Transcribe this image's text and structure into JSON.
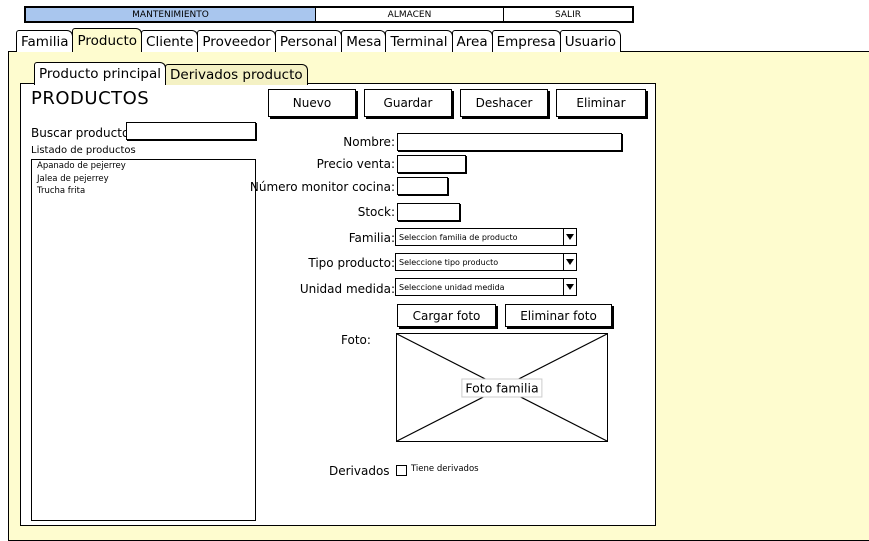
{
  "menubar": {
    "items": [
      "MANTENIMIENTO",
      "ALMACEN",
      "SALIR"
    ],
    "active_color": "#a9c6ee"
  },
  "main_tabs": [
    "Familia",
    "Producto",
    "Cliente",
    "Proveedor",
    "Personal",
    "Mesa",
    "Terminal",
    "Area",
    "Empresa",
    "Usuario"
  ],
  "active_main_tab": "Producto",
  "sub_tabs": [
    "Producto principal",
    "Derivados producto"
  ],
  "active_sub_tab": "Producto principal",
  "page": {
    "title": "PRODUCTOS"
  },
  "toolbar": {
    "nuevo": "Nuevo",
    "guardar": "Guardar",
    "deshacer": "Deshacer",
    "eliminar": "Eliminar"
  },
  "search": {
    "label": "Buscar producto:",
    "value": ""
  },
  "product_list": {
    "label": "Listado de productos",
    "items": [
      "Apanado de pejerrey",
      "Jalea de pejerrey",
      "Trucha frita"
    ]
  },
  "form": {
    "nombre": {
      "label": "Nombre:",
      "value": ""
    },
    "precio_venta": {
      "label": "Precio venta:",
      "value": ""
    },
    "numero_monitor": {
      "label": "Número monitor cocina:",
      "value": ""
    },
    "stock": {
      "label": "Stock:",
      "value": ""
    },
    "familia": {
      "label": "Familia:",
      "selected": "Seleccion familia de producto"
    },
    "tipo_producto": {
      "label": "Tipo producto:",
      "selected": "Seleccione tipo producto"
    },
    "unidad_medida": {
      "label": "Unidad medida:",
      "selected": "Seleccione unidad medida"
    },
    "foto": {
      "label": "Foto:",
      "cargar": "Cargar foto",
      "eliminar": "Eliminar foto",
      "placeholder": "Foto familia"
    },
    "derivados": {
      "label": "Derivados",
      "checkbox_label": "Tiene derivados",
      "checked": false
    }
  },
  "colors": {
    "content_bg": "#fefccf",
    "menu_active": "#a9c6ee"
  }
}
